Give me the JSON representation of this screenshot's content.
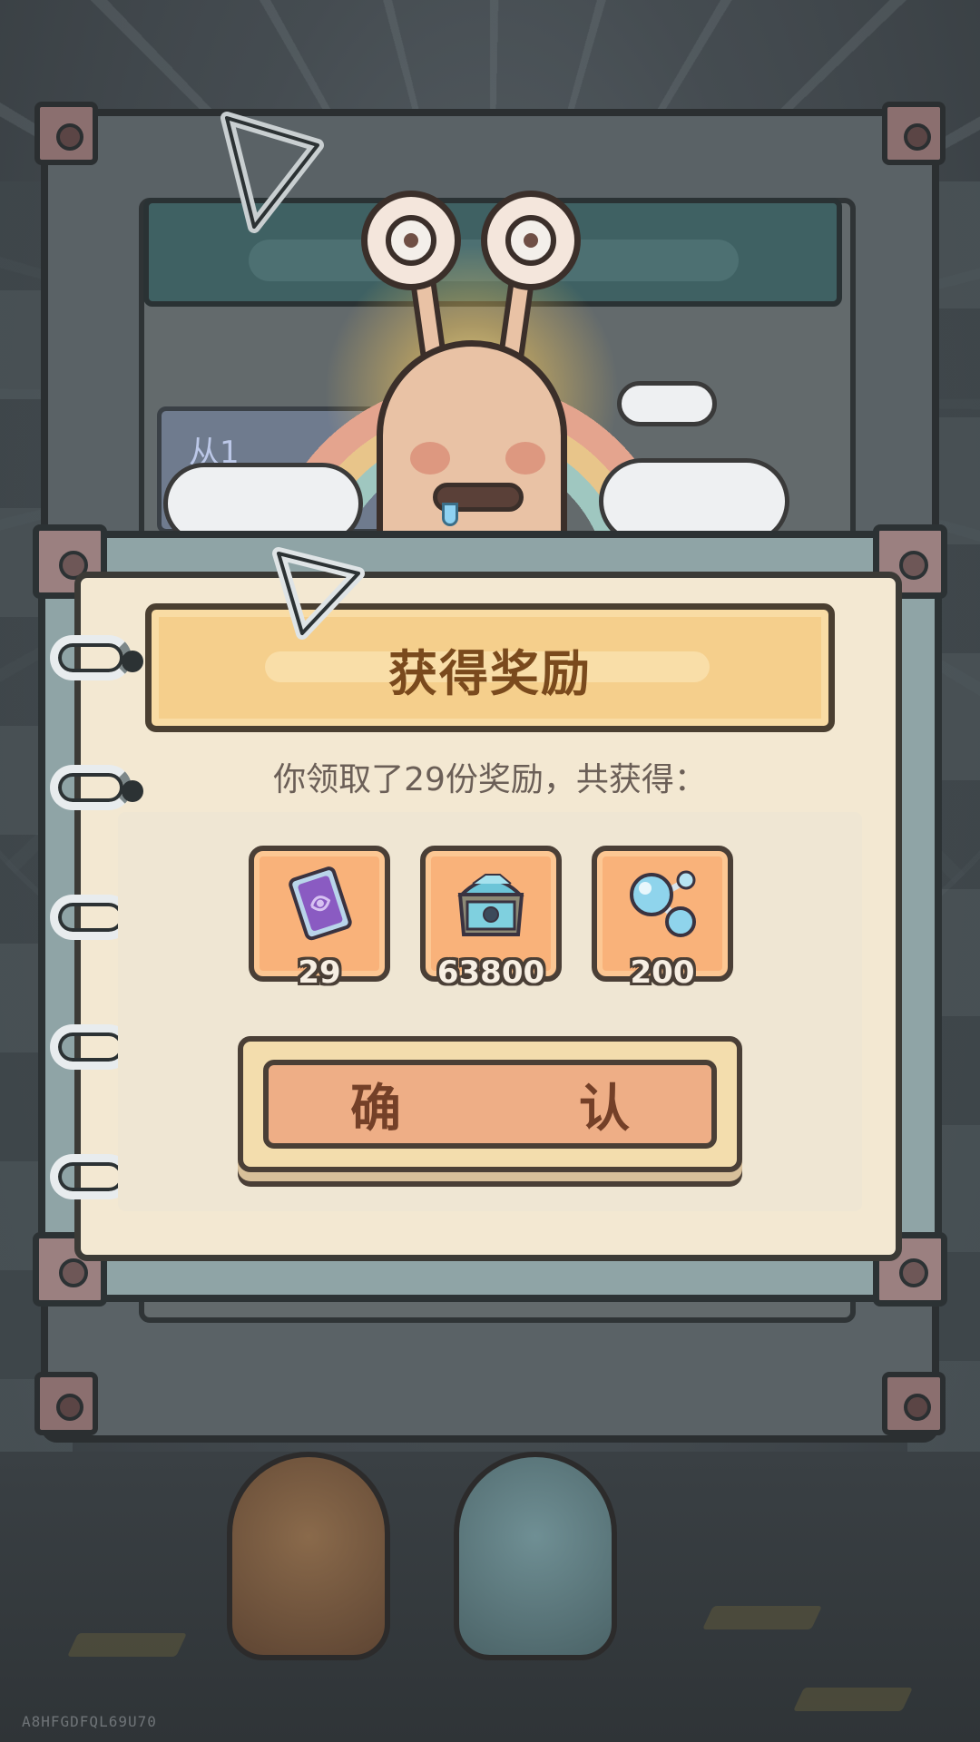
{
  "dialog": {
    "title": "获得奖励",
    "message": "你领取了29份奖励，共获得：",
    "confirm_label": "确　认"
  },
  "rewards": [
    {
      "icon": "purple-card-icon",
      "count": "29"
    },
    {
      "icon": "treasure-chest-icon",
      "count": "63800"
    },
    {
      "icon": "bubble-orbs-icon",
      "count": "200"
    }
  ],
  "background": {
    "back_panel_text": "从1",
    "watermark": "A8HFGDFQL69U70"
  },
  "colors": {
    "title_bar": "#f5cf8c",
    "reward_tile": "#f9b27a",
    "confirm_button": "#eeae86",
    "paper": "#f3e8d2"
  }
}
